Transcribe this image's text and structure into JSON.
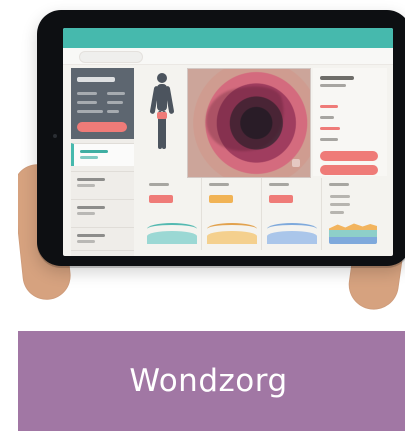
{
  "screen": {
    "caption": "Wondzorg",
    "colors": {
      "caption_background": "#a177a4",
      "accent_teal": "#46b9ad",
      "accent_coral": "#ef7b78",
      "accent_amber": "#f1b355",
      "tablet_bezel": "#0d0f12"
    }
  }
}
